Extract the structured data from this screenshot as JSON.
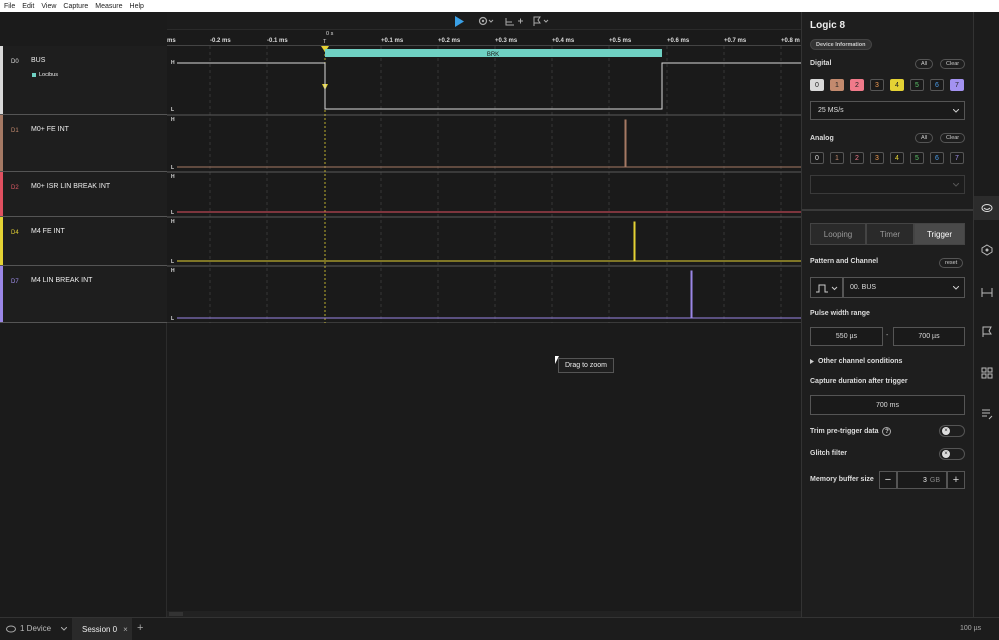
{
  "menu": [
    "File",
    "Edit",
    "View",
    "Capture",
    "Measure",
    "Help"
  ],
  "toolbar": {
    "play_icon": "play-icon",
    "gear_icon": "gear-icon",
    "measure_icon": "measure-icon",
    "flag_icon": "flag-icon",
    "plus": "+"
  },
  "ruler": {
    "zero_label": "0 s",
    "trigger_mark": "T",
    "ticks": [
      "ms",
      "-0.2 ms",
      "-0.1 ms",
      "+0.1 ms",
      "+0.2 ms",
      "+0.3 ms",
      "+0.4 ms",
      "+0.5 ms",
      "+0.6 ms",
      "+0.7 ms",
      "+0.8 m"
    ]
  },
  "channels": [
    {
      "num": "D0",
      "name": "BUS",
      "sub": "Locibus",
      "color": "#d9d9d9",
      "num_color": "#ddd"
    },
    {
      "num": "D1",
      "name": "M0+ FE INT",
      "color": "#a57964",
      "num_color": "#c38a6e"
    },
    {
      "num": "D2",
      "name": "M0+ ISR LIN BREAK INT",
      "color": "#e05060",
      "num_color": "#e05a66"
    },
    {
      "num": "D4",
      "name": "M4 FE INT",
      "color": "#e4d234",
      "num_color": "#e4d234"
    },
    {
      "num": "D7",
      "name": "M4 LIN BREAK INT",
      "color": "#9a86e6",
      "num_color": "#a392f0"
    }
  ],
  "wave": {
    "hi": "H",
    "lo": "L",
    "brk_label": "BRK",
    "brk_color": "#6fd1c3"
  },
  "tooltip": "Drag to zoom",
  "panel": {
    "title": "Logic 8",
    "device_info": "Device Information",
    "digital_label": "Digital",
    "all": "All",
    "clear": "Clear",
    "digital_channels": [
      {
        "n": "0",
        "bg": "#d9d9d9",
        "fg": "#222"
      },
      {
        "n": "1",
        "bg": "#c38a6e",
        "fg": "#222"
      },
      {
        "n": "2",
        "bg": "#f07a8a",
        "fg": "#222"
      },
      {
        "n": "3",
        "bg": "#1a1a1a",
        "fg": "#f09a50"
      },
      {
        "n": "4",
        "bg": "#e4d234",
        "fg": "#222"
      },
      {
        "n": "5",
        "bg": "#1a1a1a",
        "fg": "#5cc76a"
      },
      {
        "n": "6",
        "bg": "#1a1a1a",
        "fg": "#4a9be8"
      },
      {
        "n": "7",
        "bg": "#a392f0",
        "fg": "#222"
      }
    ],
    "sample_rate": "25 MS/s",
    "analog_label": "Analog",
    "analog_channels": [
      {
        "n": "0",
        "fg": "#ddd"
      },
      {
        "n": "1",
        "fg": "#c38a6e"
      },
      {
        "n": "2",
        "fg": "#f07a8a"
      },
      {
        "n": "3",
        "fg": "#f09a50"
      },
      {
        "n": "4",
        "fg": "#e4d234"
      },
      {
        "n": "5",
        "fg": "#5cc76a"
      },
      {
        "n": "6",
        "fg": "#4a9be8"
      },
      {
        "n": "7",
        "fg": "#a392f0"
      }
    ],
    "modes": [
      "Looping",
      "Timer",
      "Trigger"
    ],
    "pattern_label": "Pattern and Channel",
    "reset": "reset",
    "channel_select": "00.  BUS",
    "pulse_label": "Pulse width range",
    "pulse_min": "550 µs",
    "pulse_dash": "-",
    "pulse_max": "700 µs",
    "other_conditions": "Other channel conditions",
    "capture_label": "Capture duration after trigger",
    "capture_value": "700 ms",
    "trim_label": "Trim pre-trigger data",
    "glitch_label": "Glitch filter",
    "memory_label": "Memory buffer size",
    "memory_value": "3",
    "memory_unit": "GB",
    "minus": "−",
    "plus": "+"
  },
  "rail_icons": [
    "device-settings-icon",
    "analyzer-icon",
    "measurements-icon",
    "timing-marker-icon",
    "extensions-icon",
    "notes-icon"
  ],
  "status": {
    "devices": "1 Device",
    "session": "Session 0",
    "close": "×",
    "add": "+",
    "zoom": "100 µs"
  }
}
